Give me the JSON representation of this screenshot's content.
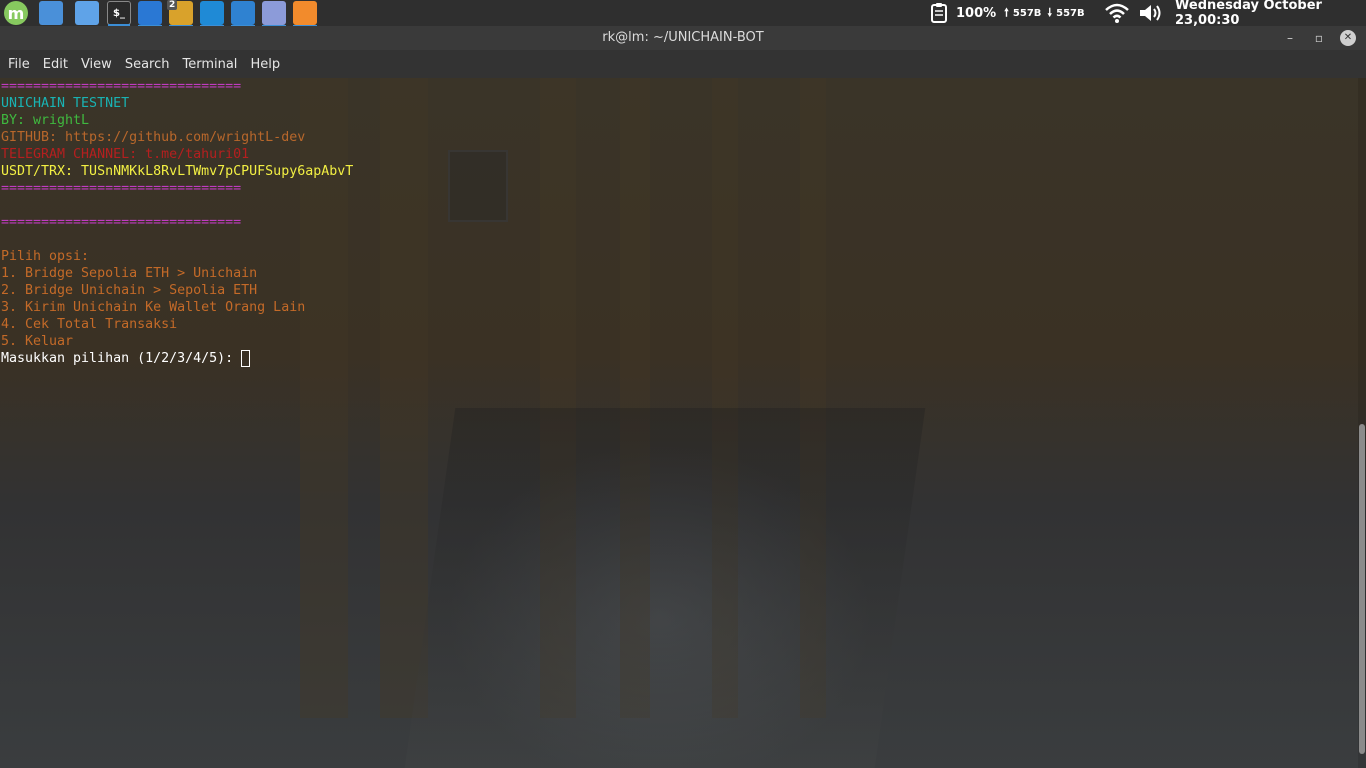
{
  "panel": {
    "launchers": [
      {
        "name": "mint-menu",
        "glyph": "m",
        "color": "#87c95f"
      },
      {
        "name": "show-desktop",
        "glyph": "",
        "color": "#4a90d9"
      },
      {
        "name": "files",
        "glyph": "",
        "color": "#5fa3e8"
      },
      {
        "name": "terminal",
        "glyph": "$_",
        "color": "#2a2a2a"
      },
      {
        "name": "vscode",
        "glyph": "",
        "color": "#2a78d4"
      },
      {
        "name": "chrome",
        "glyph": "",
        "color": "#d9a22b"
      },
      {
        "name": "edge",
        "glyph": "",
        "color": "#1f8ad6"
      },
      {
        "name": "screenshot",
        "glyph": "",
        "color": "#2f82d1"
      },
      {
        "name": "text-editor",
        "glyph": "",
        "color": "#8c9bd9"
      },
      {
        "name": "ubuntu-app",
        "glyph": "",
        "color": "#f28b2c"
      }
    ],
    "chrome_badge": "2",
    "battery": "100%",
    "upload": "557B",
    "download": "557B",
    "clock": "Wednesday October 23,00:30"
  },
  "window": {
    "title": "rk@lm: ~/UNICHAIN-BOT",
    "minimize": "–",
    "maximize": "▫",
    "close": "✕"
  },
  "menu": [
    "File",
    "Edit",
    "View",
    "Search",
    "Terminal",
    "Help"
  ],
  "terminal": {
    "lines": [
      {
        "text": "==============================",
        "color": "#c13bc1"
      },
      {
        "text": "UNICHAIN TESTNET",
        "color": "#19b3b3"
      },
      {
        "text": "BY: wrightL",
        "color": "#3fb93f"
      },
      {
        "text": "GITHUB: https://github.com/wrightL-dev",
        "color": "#b8672b"
      },
      {
        "text": "TELEGRAM CHANNEL: t.me/tahuri01",
        "color": "#b51f1f"
      },
      {
        "text": "USDT/TRX: TUSnNMKkL8RvLTWmv7pCPUFSupy6apAbvT",
        "color": "#f2ef43"
      },
      {
        "text": "==============================",
        "color": "#c13bc1"
      },
      {
        "text": "",
        "color": "#ffffff"
      },
      {
        "text": "==============================",
        "color": "#c13bc1"
      },
      {
        "text": "",
        "color": "#ffffff"
      },
      {
        "text": "Pilih opsi:",
        "color": "#c46a28"
      },
      {
        "text": "1. Bridge Sepolia ETH > Unichain",
        "color": "#c46a28"
      },
      {
        "text": "2. Bridge Unichain > Sepolia ETH",
        "color": "#c46a28"
      },
      {
        "text": "3. Kirim Unichain Ke Wallet Orang Lain",
        "color": "#c46a28"
      },
      {
        "text": "4. Cek Total Transaksi",
        "color": "#c46a28"
      },
      {
        "text": "5. Keluar",
        "color": "#c46a28"
      }
    ],
    "prompt": "Masukkan pilihan (1/2/3/4/5): ",
    "prompt_color": "#ffffff"
  }
}
